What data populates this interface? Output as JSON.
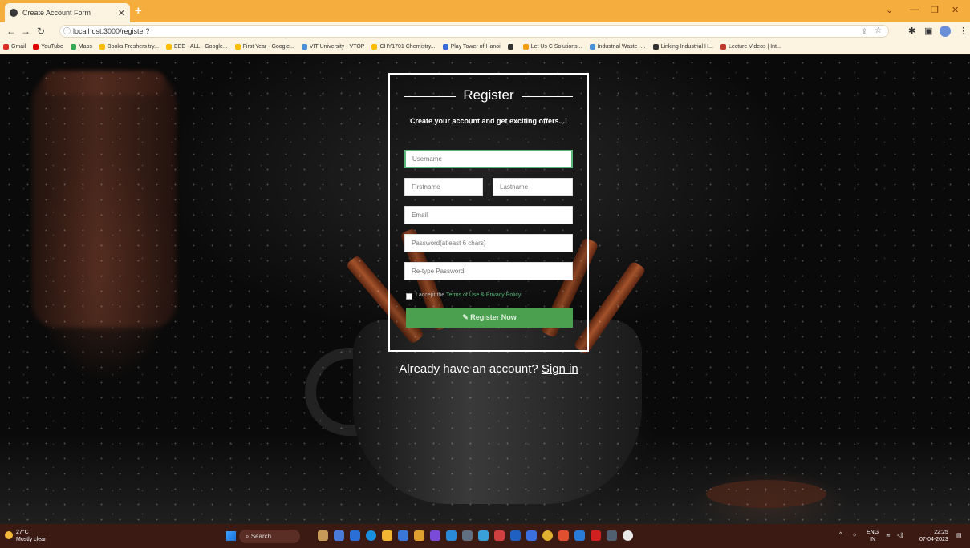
{
  "browser": {
    "tab_title": "Create Account Form",
    "url": "localhost:3000/register?",
    "bookmarks": [
      {
        "label": "Gmail",
        "color": "#d93025"
      },
      {
        "label": "YouTube",
        "color": "#e00000"
      },
      {
        "label": "Maps",
        "color": "#34a853"
      },
      {
        "label": "Books Freshers try...",
        "color": "#fbbc05"
      },
      {
        "label": "EEE - ALL - Google...",
        "color": "#fbbc05"
      },
      {
        "label": "First Year - Google...",
        "color": "#fbbc05"
      },
      {
        "label": "VIT University - VTOP",
        "color": "#4a90d9"
      },
      {
        "label": "CHY1701 Chemistry...",
        "color": "#fbbc05"
      },
      {
        "label": "Play Tower of Hanoi",
        "color": "#3a6bd8"
      },
      {
        "label": "",
        "color": "#333333"
      },
      {
        "label": "Let Us C Solutions...",
        "color": "#f39c12"
      },
      {
        "label": "Industrial Waste -...",
        "color": "#4a90d9"
      },
      {
        "label": "Linking Industrial H...",
        "color": "#333333"
      },
      {
        "label": "Lecture Videos | Int...",
        "color": "#c0392b"
      }
    ]
  },
  "form": {
    "title": "Register",
    "subtitle": "Create your account and get exciting offers...!",
    "username_placeholder": "Username",
    "firstname_placeholder": "Firstname",
    "lastname_placeholder": "Lastname",
    "email_placeholder": "Email",
    "password_placeholder": "Password(atleast 6 chars)",
    "retype_placeholder": "Re-type Password",
    "terms_prefix": "I accept the",
    "terms_link": "Terms of Use & Privacy Policy",
    "register_label": "Register Now",
    "register_icon": "edit-icon",
    "signin_prefix": "Already have an account?",
    "signin_link": "Sign in",
    "accent_color": "#4aa04e"
  },
  "taskbar": {
    "temperature": "27°C",
    "weather": "Mostly clear",
    "search_label": "Search",
    "lang": "ENG",
    "lang_region": "IN",
    "time": "22:25",
    "date": "07-04-2023"
  }
}
